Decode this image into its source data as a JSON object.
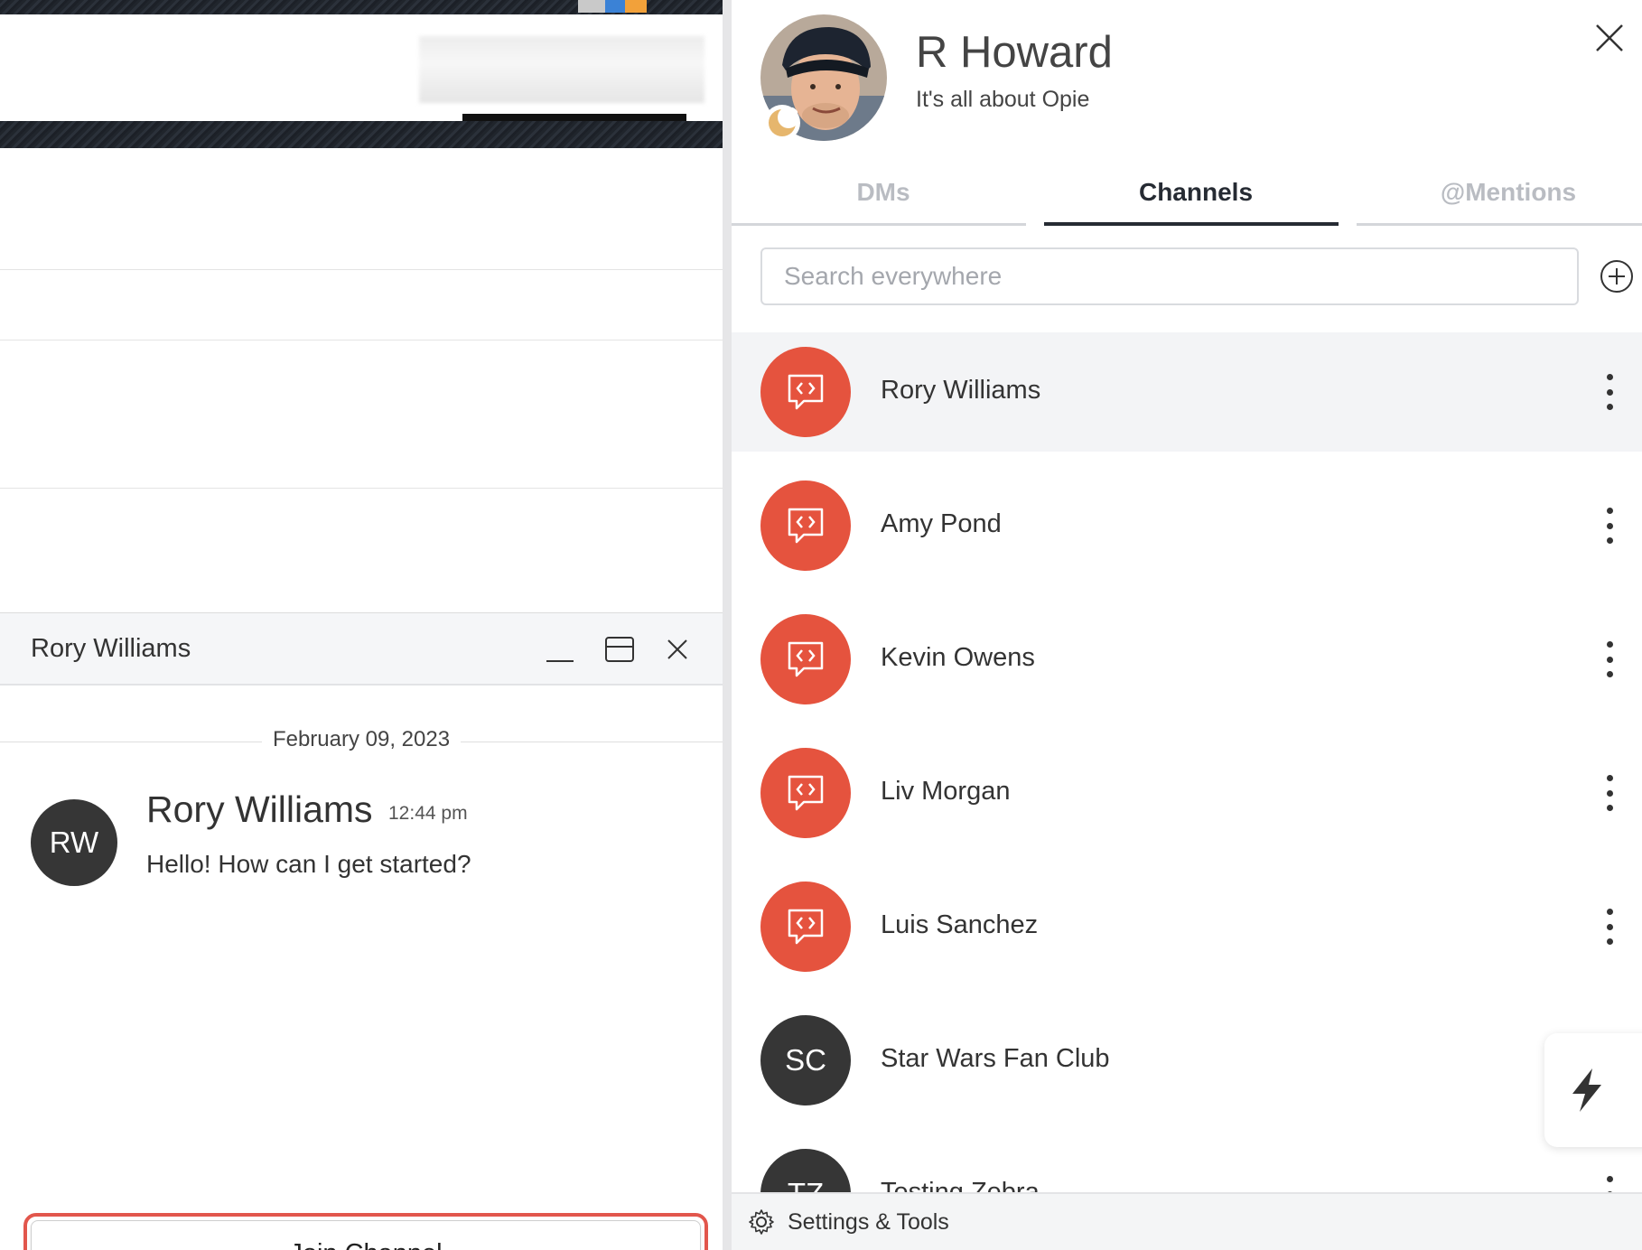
{
  "chat_window": {
    "title": "Rory Williams",
    "date_separator": "February 09, 2023",
    "message": {
      "avatar_initials": "RW",
      "author": "Rory Williams",
      "time": "12:44 pm",
      "text": "Hello! How can I get started?"
    },
    "join_button": "Join Channel"
  },
  "profile": {
    "name": "R Howard",
    "tagline": "It's all about Opie"
  },
  "tabs": [
    {
      "label": "DMs",
      "active": false
    },
    {
      "label": "Channels",
      "active": true
    },
    {
      "label": "@Mentions",
      "active": false
    }
  ],
  "search": {
    "placeholder": "Search everywhere"
  },
  "channels": [
    {
      "name": "Rory Williams",
      "avatar_type": "channel-icon",
      "selected": true
    },
    {
      "name": "Amy Pond",
      "avatar_type": "channel-icon",
      "selected": false
    },
    {
      "name": "Kevin Owens",
      "avatar_type": "channel-icon",
      "selected": false
    },
    {
      "name": "Liv Morgan",
      "avatar_type": "channel-icon",
      "selected": false
    },
    {
      "name": "Luis Sanchez",
      "avatar_type": "channel-icon",
      "selected": false
    },
    {
      "name": "Star Wars Fan Club",
      "avatar_type": "initials",
      "initials": "SC",
      "selected": false
    },
    {
      "name": "Testing Zebra",
      "avatar_type": "initials",
      "initials": "TZ",
      "selected": false
    }
  ],
  "footer": {
    "label": "Settings & Tools"
  },
  "colors": {
    "channel_avatar": "#e5533e",
    "initials_avatar": "#363636",
    "highlight_border": "#e2564c",
    "active_tab": "#262b33"
  }
}
